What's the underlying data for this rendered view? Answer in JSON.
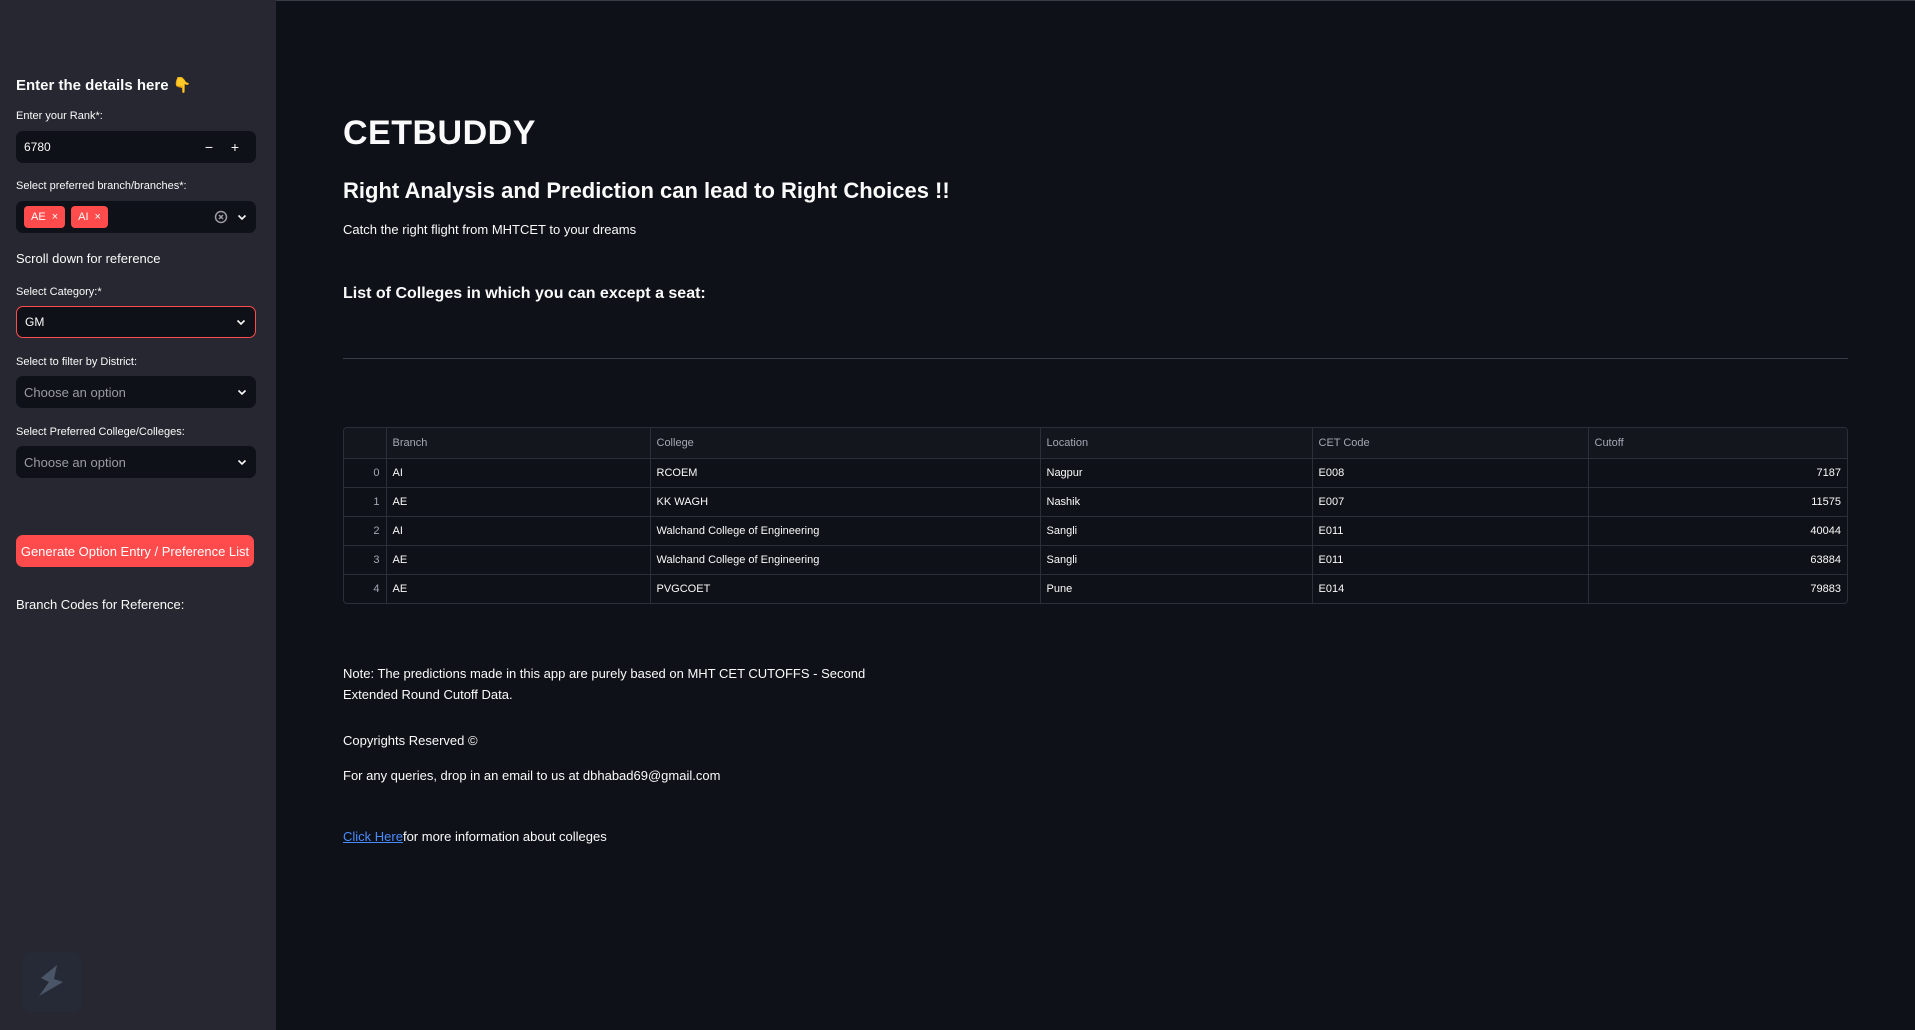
{
  "sidebar": {
    "heading": "Enter the details here 👇",
    "rank": {
      "label": "Enter your Rank*:",
      "value": "6780",
      "minus": "−",
      "plus": "+"
    },
    "branch": {
      "label": "Select preferred branch/branches*:",
      "tags": [
        "AE",
        "AI"
      ],
      "remove": "×"
    },
    "scroll_note": "Scroll down for reference",
    "category": {
      "label": "Select Category:*",
      "value": "GM"
    },
    "district": {
      "label": "Select to filter by District:",
      "placeholder": "Choose an option"
    },
    "college": {
      "label": "Select Preferred College/Colleges:",
      "placeholder": "Choose an option"
    },
    "generate_button": "Generate Option Entry / Preference List",
    "branch_codes_title": "Branch Codes for Reference:"
  },
  "main": {
    "title": "CETBUDDY",
    "subtitle": "Right Analysis and Prediction can lead to Right Choices !!",
    "caption": "Catch the right flight from MHTCET to your dreams",
    "list_heading": "List of Colleges in which you can except a seat:",
    "table": {
      "columns": [
        "",
        "Branch",
        "College",
        "Location",
        "CET Code",
        "Cutoff"
      ],
      "rows": [
        [
          "0",
          "AI",
          "RCOEM",
          "Nagpur",
          "E008",
          "7187"
        ],
        [
          "1",
          "AE",
          "KK WAGH",
          "Nashik",
          "E007",
          "11575"
        ],
        [
          "2",
          "AI",
          "Walchand College of Engineering",
          "Sangli",
          "E011",
          "40044"
        ],
        [
          "3",
          "AE",
          "Walchand College of Engineering",
          "Sangli",
          "E011",
          "63884"
        ],
        [
          "4",
          "AE",
          "PVGCOET",
          "Pune",
          "E014",
          "79883"
        ]
      ]
    },
    "note": "Note: The predictions made in this app are purely based on MHT CET CUTOFFS - Second Extended Round Cutoff Data.",
    "copyright": "Copyrights Reserved ©",
    "query": "For any queries, drop in an email to us at dbhabad69@gmail.com",
    "link_text": "Click Here",
    "link_suffix": "for more information about colleges"
  },
  "colors": {
    "accent": "#ff4b4b",
    "background": "#0e1117",
    "sidebar": "#262730",
    "link": "#4a8bff"
  }
}
